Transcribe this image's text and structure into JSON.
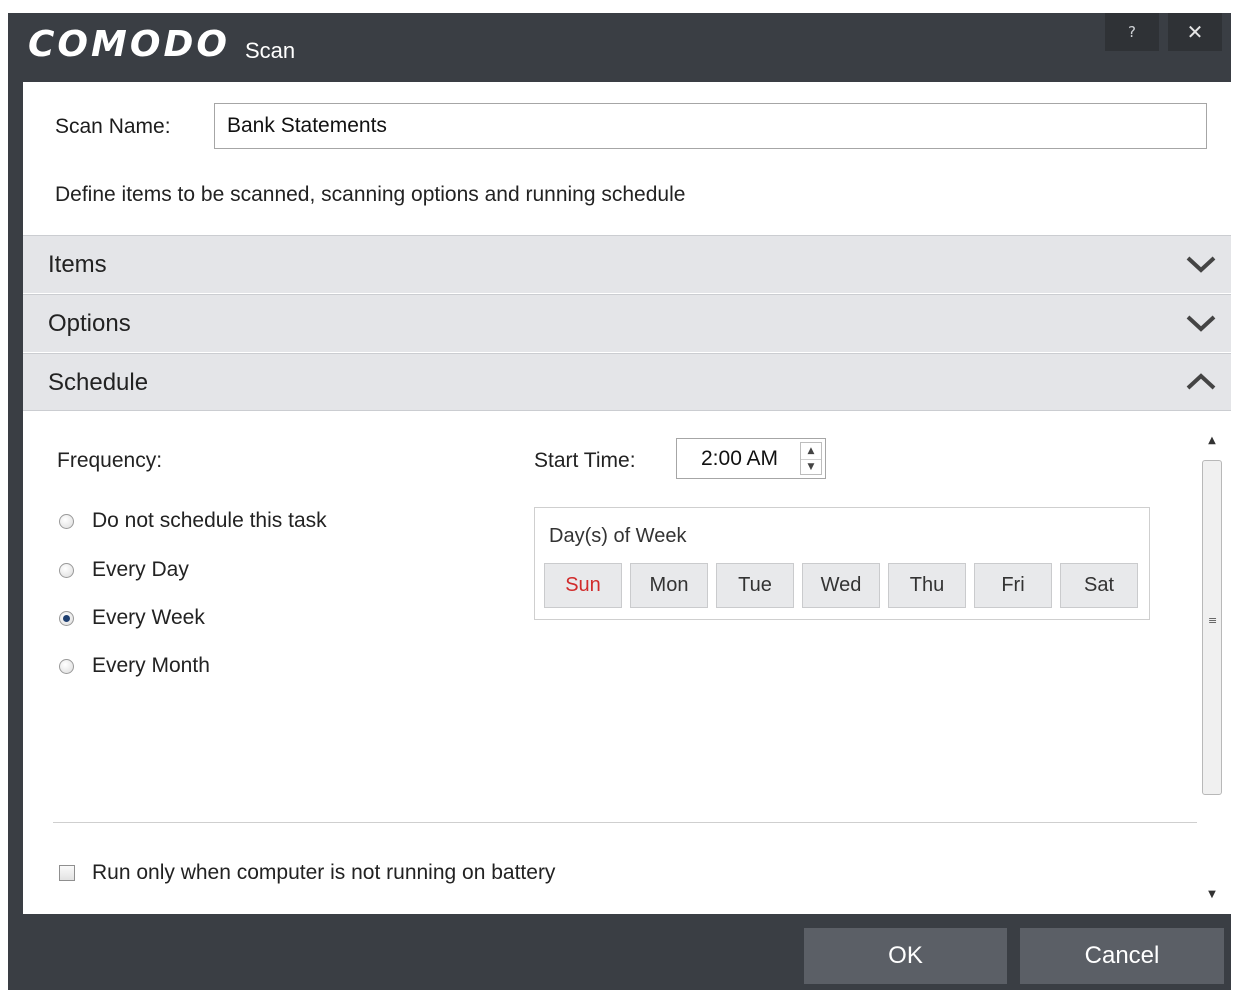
{
  "window": {
    "logo": "COMODO",
    "title": "Scan",
    "help_icon": "?",
    "close_icon": "✕"
  },
  "form": {
    "scan_name_label": "Scan Name:",
    "scan_name_value": "Bank Statements",
    "description": "Define items to be scanned, scanning options and running schedule"
  },
  "sections": [
    {
      "label": "Items",
      "state": "collapsed",
      "icon": "chevron-down-icon"
    },
    {
      "label": "Options",
      "state": "collapsed",
      "icon": "chevron-down-icon"
    },
    {
      "label": "Schedule",
      "state": "expanded",
      "icon": "chevron-up-icon"
    }
  ],
  "schedule": {
    "frequency_label": "Frequency:",
    "frequency_options": [
      {
        "label": "Do not schedule this task",
        "checked": false
      },
      {
        "label": "Every Day",
        "checked": false
      },
      {
        "label": "Every Week",
        "checked": true
      },
      {
        "label": "Every Month",
        "checked": false
      }
    ],
    "start_time_label": "Start Time:",
    "start_time_value": "2:00 AM",
    "days_label": "Day(s) of Week",
    "days": [
      "Sun",
      "Mon",
      "Tue",
      "Wed",
      "Thu",
      "Fri",
      "Sat"
    ],
    "selected_day": "Sun",
    "battery_option": {
      "label": "Run only when computer is not running on battery",
      "checked": false
    }
  },
  "buttons": {
    "ok": "OK",
    "cancel": "Cancel"
  },
  "colors": {
    "chrome": "#3a3e44",
    "button": "#5b5f66",
    "section_header": "#e4e5e8",
    "accent_day": "#d12b2b"
  }
}
